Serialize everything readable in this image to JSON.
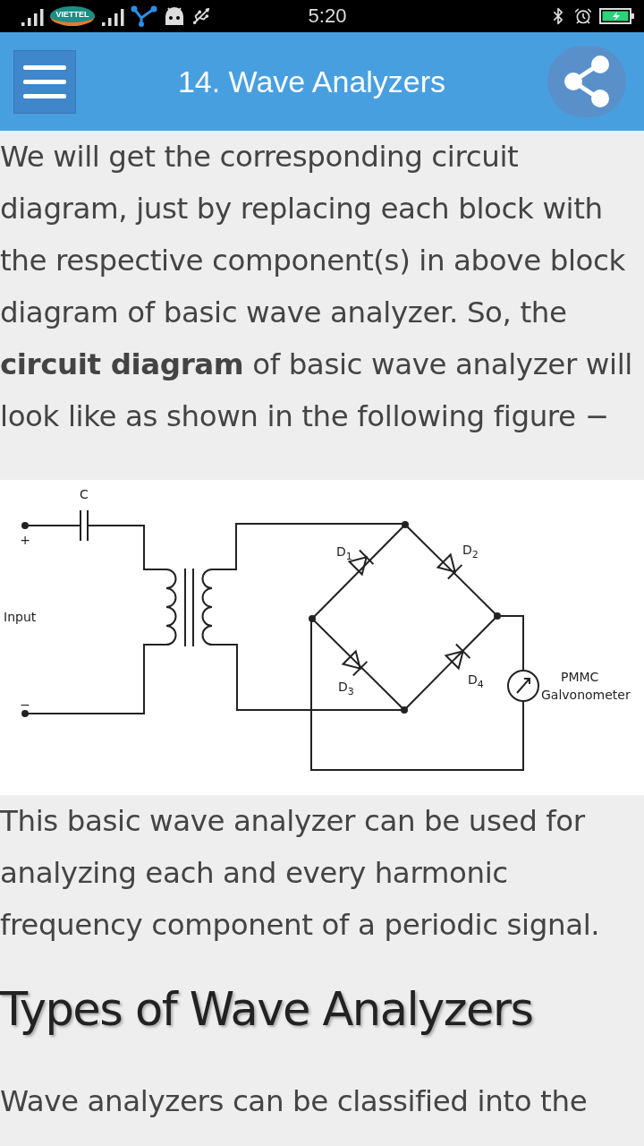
{
  "status_bar": {
    "carrier": "VIETTEL",
    "time": "5:20"
  },
  "app_bar": {
    "title": "14. Wave Analyzers"
  },
  "content": [
    {
      "kind": "paragraph",
      "lines": [
        "We will get the corresponding circuit",
        "diagram, just by replacing each block with",
        "the respective component(s) in above block",
        "diagram of basic wave analyzer. So, the",
        "**circuit diagram** of basic wave analyzer will",
        "look like as shown in the following figure −"
      ]
    },
    {
      "kind": "figure",
      "labels": [
        {
          "text": "C"
        },
        {
          "text": "+"
        },
        {
          "text": "Input"
        },
        {
          "text": "−"
        },
        {
          "text": "D",
          "sub": "1"
        },
        {
          "text": "D",
          "sub": "2"
        },
        {
          "text": "D",
          "sub": "3"
        },
        {
          "text": "D",
          "sub": "4"
        },
        {
          "text": "PMMC"
        },
        {
          "text": "Galvonometer"
        }
      ]
    },
    {
      "kind": "paragraph",
      "lines": [
        "This basic wave analyzer can be used for",
        "analyzing each and every harmonic",
        "frequency component of a periodic signal."
      ]
    },
    {
      "kind": "heading",
      "text": "Types of Wave Analyzers"
    },
    {
      "kind": "paragraph",
      "lines": [
        "Wave analyzers can be classified into the"
      ]
    }
  ]
}
